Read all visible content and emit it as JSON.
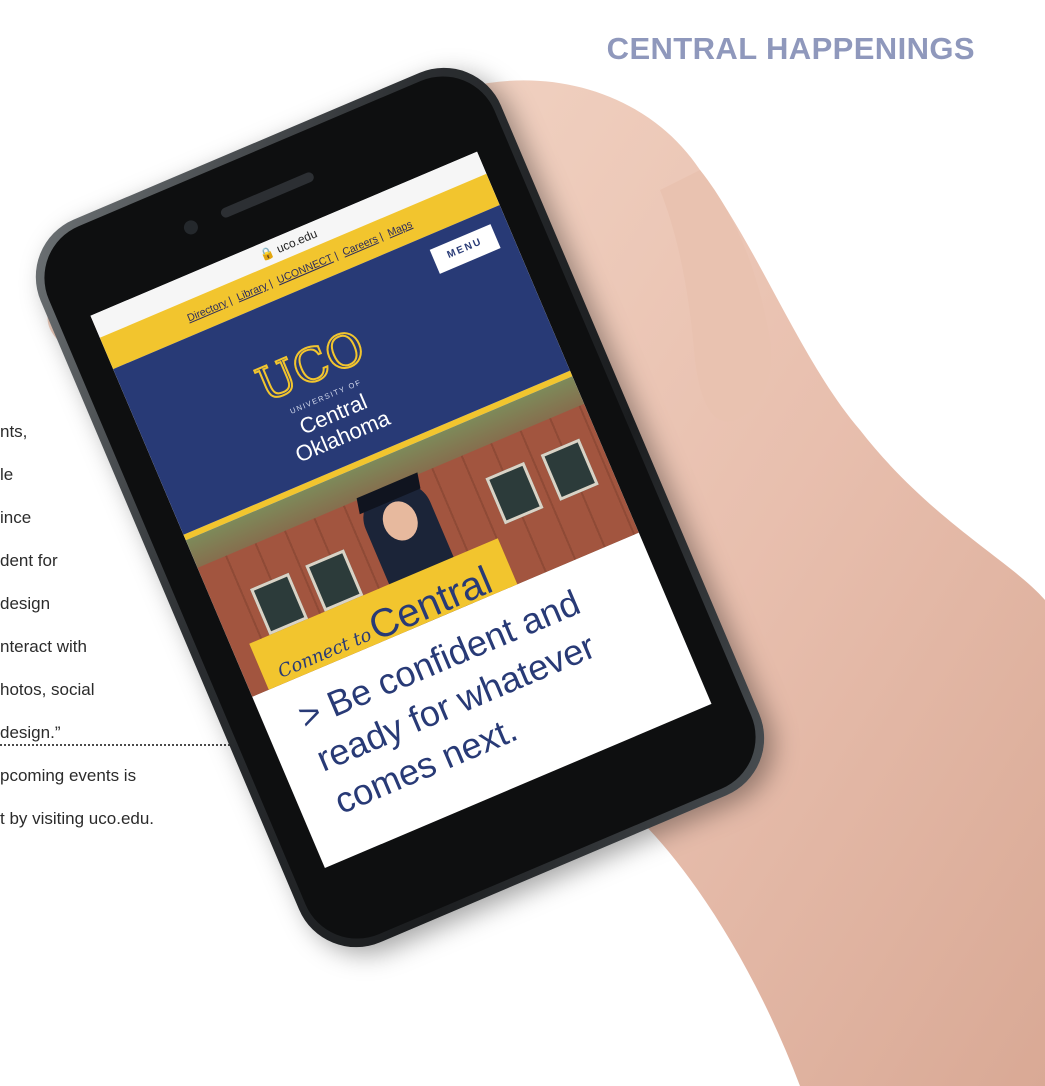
{
  "section_title": "CENTRAL HAPPENINGS",
  "article_lines": [
    "nts,",
    "le",
    "ince",
    "dent for",
    "design",
    "nteract with",
    "hotos, social",
    "design.”",
    "pcoming events is",
    "t by visiting uco.edu."
  ],
  "phone": {
    "url": "uco.edu",
    "utility_links": [
      "Directory",
      "Library",
      "UCONNECT",
      "Careers",
      "Maps"
    ],
    "menu_label": "MENU",
    "logo_text": "UCO",
    "logo_small": "UNIVERSITY OF",
    "logo_name_line1": "Central",
    "logo_name_line2": "Oklahoma",
    "connect_script": "Connect to",
    "connect_big": "Central",
    "tagline": "> Be confident and ready for whatever comes next.",
    "icons": {
      "lock": "lock-icon"
    }
  },
  "colors": {
    "title": "#8f98bc",
    "uco_blue": "#283a76",
    "uco_gold": "#f2c52e"
  }
}
